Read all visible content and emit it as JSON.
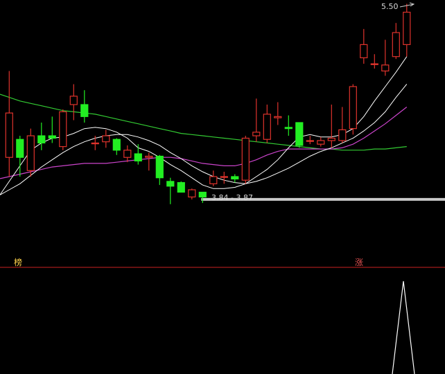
{
  "chart_data": {
    "type": "candlestick",
    "annotations": {
      "high_label": "5.50",
      "support_label": "3.84 - 3.87",
      "separator_left": "榜",
      "separator_right": "涨"
    },
    "colors": {
      "up": "#e0332c",
      "down": "#22ee22",
      "ma_short": "#ffffff",
      "ma_mid": "#ffffff",
      "ma_long1": "#cc44cc",
      "ma_long2": "#33cc33",
      "support_line": "#c8c8c8",
      "separator": "#cc2222",
      "indicator": "#ffffff"
    },
    "candles": [
      {
        "o": 4.22,
        "c": 4.59,
        "h": 4.94,
        "l": 4.06
      },
      {
        "o": 4.37,
        "c": 4.22,
        "h": 4.4,
        "l": 4.06
      },
      {
        "o": 4.11,
        "c": 4.4,
        "h": 4.46,
        "l": 4.06
      },
      {
        "o": 4.4,
        "c": 4.34,
        "h": 4.51,
        "l": 4.28
      },
      {
        "o": 4.4,
        "c": 4.38,
        "h": 4.56,
        "l": 4.34
      },
      {
        "o": 4.31,
        "c": 4.6,
        "h": 4.62,
        "l": 4.28
      },
      {
        "o": 4.66,
        "c": 4.73,
        "h": 4.83,
        "l": 4.53
      },
      {
        "o": 4.66,
        "c": 4.56,
        "h": 4.78,
        "l": 4.51
      },
      {
        "o": 4.34,
        "c": 4.34,
        "h": 4.4,
        "l": 4.28
      },
      {
        "o": 4.35,
        "c": 4.4,
        "h": 4.45,
        "l": 4.3
      },
      {
        "o": 4.37,
        "c": 4.28,
        "h": 4.38,
        "l": 4.24
      },
      {
        "o": 4.22,
        "c": 4.28,
        "h": 4.32,
        "l": 4.18
      },
      {
        "o": 4.25,
        "c": 4.19,
        "h": 4.33,
        "l": 4.16
      },
      {
        "o": 4.22,
        "c": 4.23,
        "h": 4.26,
        "l": 4.11
      },
      {
        "o": 4.23,
        "c": 4.05,
        "h": 4.24,
        "l": 3.99
      },
      {
        "o": 4.02,
        "c": 3.98,
        "h": 4.05,
        "l": 3.83
      },
      {
        "o": 4.01,
        "c": 3.93,
        "h": 4.02,
        "l": 3.93
      },
      {
        "o": 3.89,
        "c": 3.95,
        "h": 3.96,
        "l": 3.87
      },
      {
        "o": 3.93,
        "c": 3.89,
        "h": 3.92,
        "l": 3.84
      },
      {
        "o": 4.0,
        "c": 4.06,
        "h": 4.11,
        "l": 3.98
      },
      {
        "o": 4.06,
        "c": 4.06,
        "h": 4.1,
        "l": 4.0
      },
      {
        "o": 4.06,
        "c": 4.04,
        "h": 4.08,
        "l": 4.01
      },
      {
        "o": 4.03,
        "c": 4.38,
        "h": 4.4,
        "l": 4.0
      },
      {
        "o": 4.4,
        "c": 4.43,
        "h": 4.71,
        "l": 4.35
      },
      {
        "o": 4.37,
        "c": 4.58,
        "h": 4.66,
        "l": 4.34
      },
      {
        "o": 4.55,
        "c": 4.56,
        "h": 4.68,
        "l": 4.49
      },
      {
        "o": 4.47,
        "c": 4.46,
        "h": 4.57,
        "l": 4.4
      },
      {
        "o": 4.51,
        "c": 4.32,
        "h": 4.51,
        "l": 4.3
      },
      {
        "o": 4.36,
        "c": 4.36,
        "h": 4.4,
        "l": 4.33
      },
      {
        "o": 4.33,
        "c": 4.36,
        "h": 4.39,
        "l": 4.31
      },
      {
        "o": 4.36,
        "c": 4.38,
        "h": 4.66,
        "l": 4.3
      },
      {
        "o": 4.36,
        "c": 4.45,
        "h": 4.64,
        "l": 4.34
      },
      {
        "o": 4.46,
        "c": 4.81,
        "h": 4.83,
        "l": 4.41
      },
      {
        "o": 5.05,
        "c": 5.16,
        "h": 5.29,
        "l": 5.0
      },
      {
        "o": 5.0,
        "c": 5.0,
        "h": 5.08,
        "l": 4.96
      },
      {
        "o": 4.94,
        "c": 4.99,
        "h": 5.2,
        "l": 4.9
      },
      {
        "o": 5.06,
        "c": 5.26,
        "h": 5.34,
        "l": 5.04
      },
      {
        "o": 5.16,
        "c": 5.43,
        "h": 5.5,
        "l": 5.06
      }
    ],
    "ma_short": [
      4.02,
      4.15,
      4.28,
      4.34,
      4.38,
      4.39,
      4.42,
      4.46,
      4.47,
      4.46,
      4.43,
      4.38,
      4.3,
      4.27,
      4.22,
      4.16,
      4.11,
      4.05,
      3.99,
      3.96,
      3.96,
      3.97,
      4.0,
      4.06,
      4.12,
      4.2,
      4.3,
      4.39,
      4.41,
      4.39,
      4.39,
      4.41,
      4.46,
      4.56,
      4.69,
      4.81,
      4.93,
      5.06
    ],
    "ma_mid": [
      3.95,
      4.0,
      4.07,
      4.14,
      4.2,
      4.26,
      4.31,
      4.35,
      4.38,
      4.4,
      4.41,
      4.41,
      4.39,
      4.36,
      4.32,
      4.26,
      4.21,
      4.15,
      4.1,
      4.06,
      4.03,
      4.01,
      4.0,
      4.02,
      4.05,
      4.09,
      4.13,
      4.18,
      4.23,
      4.27,
      4.3,
      4.34,
      4.38,
      4.44,
      4.51,
      4.6,
      4.72,
      4.83
    ],
    "ma_long1": [
      4.06,
      4.08,
      4.1,
      4.12,
      4.14,
      4.15,
      4.16,
      4.17,
      4.17,
      4.17,
      4.18,
      4.19,
      4.2,
      4.21,
      4.22,
      4.22,
      4.21,
      4.19,
      4.17,
      4.16,
      4.15,
      4.15,
      4.17,
      4.2,
      4.24,
      4.27,
      4.29,
      4.29,
      4.29,
      4.29,
      4.29,
      4.3,
      4.33,
      4.38,
      4.44,
      4.5,
      4.57,
      4.64
    ],
    "ma_long2": [
      4.72,
      4.69,
      4.67,
      4.65,
      4.63,
      4.61,
      4.6,
      4.59,
      4.58,
      4.56,
      4.54,
      4.52,
      4.5,
      4.48,
      4.46,
      4.44,
      4.42,
      4.41,
      4.4,
      4.39,
      4.38,
      4.37,
      4.36,
      4.35,
      4.34,
      4.33,
      4.32,
      4.31,
      4.3,
      4.29,
      4.29,
      4.28,
      4.28,
      4.28,
      4.29,
      4.29,
      4.3,
      4.31
    ],
    "support_level": 3.87,
    "indicator_spike": [
      0,
      1,
      0
    ],
    "y_range": [
      3.8,
      5.52
    ]
  }
}
